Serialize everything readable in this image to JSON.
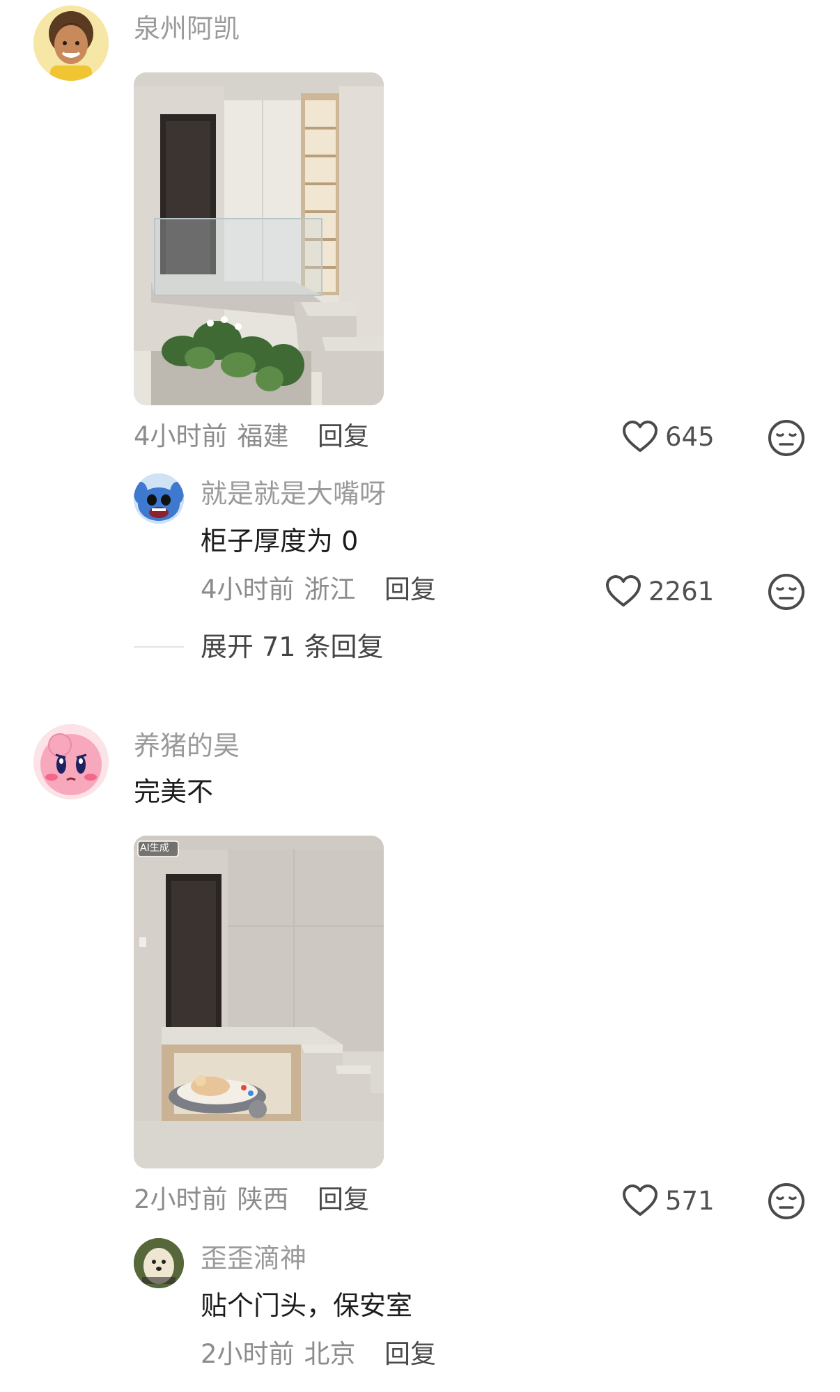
{
  "comments": [
    {
      "username": "泉州阿凯",
      "time": "4小时前",
      "location": "福建",
      "reply_label": "回复",
      "likes": "645",
      "sub_reply": {
        "username": "就是就是大嘴呀",
        "text": "柜子厚度为 0",
        "time": "4小时前",
        "location": "浙江",
        "reply_label": "回复",
        "likes": "2261"
      },
      "expand_label": "展开 71 条回复"
    },
    {
      "username": "养猪的昊",
      "text": "完美不",
      "image_badge": "AI生成",
      "time": "2小时前",
      "location": "陕西",
      "reply_label": "回复",
      "likes": "571",
      "sub_reply": {
        "username": "歪歪滴神",
        "text": "贴个门头，保安室",
        "time": "2小时前",
        "location": "北京",
        "reply_label": "回复"
      }
    }
  ],
  "icons": {
    "like": "heart-outline-icon",
    "emoji": "neutral-face-icon"
  },
  "colors": {
    "username": "#9a9a9a",
    "text": "#1c1c1c",
    "meta": "#8c8c8c"
  }
}
